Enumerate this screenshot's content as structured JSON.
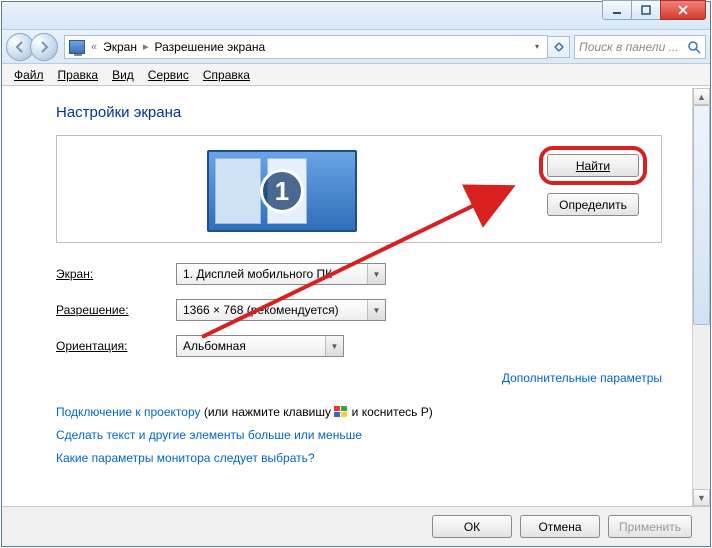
{
  "titlebar": {
    "minimize_icon": "minimize-icon",
    "maximize_icon": "maximize-icon",
    "close_icon": "close-icon"
  },
  "nav": {
    "back_icon": "back-arrow-icon",
    "forward_icon": "forward-arrow-icon",
    "crumb1": "Экран",
    "crumb2": "Разрешение экрана",
    "refresh_icon": "refresh-icon",
    "search_placeholder": "Поиск в панели ...",
    "search_icon": "search-icon"
  },
  "menu": {
    "file": "Файл",
    "edit": "Правка",
    "view": "Вид",
    "service": "Сервис",
    "help": "Справка"
  },
  "page": {
    "title": "Настройки экрана",
    "monitor_number": "1",
    "find_btn": "Найти",
    "detect_btn": "Определить",
    "row_screen_label": "Экран:",
    "row_screen_value": "1. Дисплей мобильного ПК",
    "row_res_label": "Разрешение:",
    "row_res_value": "1366 × 768 (рекомендуется)",
    "row_orient_label": "Ориентация:",
    "row_orient_value": "Альбомная",
    "advanced_link": "Дополнительные параметры",
    "projector_link": "Подключение к проектору",
    "projector_tail_a": " (или нажмите клавишу ",
    "projector_tail_b": " и коснитесь P)",
    "text_size_link": "Сделать текст и другие элементы больше или меньше",
    "which_monitor_link": "Какие параметры монитора следует выбрать?"
  },
  "footer": {
    "ok": "ОК",
    "cancel": "Отмена",
    "apply": "Применить"
  },
  "colors": {
    "link": "#0066cc",
    "title": "#003399",
    "highlight": "#d92020"
  }
}
